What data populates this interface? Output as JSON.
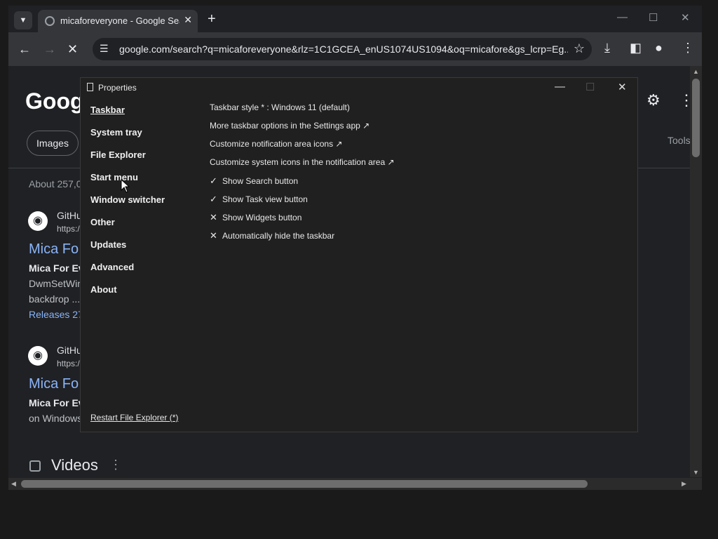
{
  "browser": {
    "tab_title": "micaforeveryone - Google Search",
    "url": "google.com/search?q=micaforeveryone&rlz=1C1GCEA_enUS1074US1094&oq=micafore&gs_lcrp=Eg..."
  },
  "google": {
    "logo": "Googl",
    "chip_images": "Images",
    "tools": "Tools",
    "about": "About 257,0",
    "results": [
      {
        "source": "GitHu",
        "url": "https:/",
        "title": "Mica Fo",
        "snippet1": "Mica For Ev",
        "snippet2": "DwmSetWin",
        "snippet3": "backdrop ...",
        "link": "Releases 27"
      },
      {
        "source": "GitHu",
        "url": "https:/",
        "title": "Mica Fo",
        "snippet1": "Mica For Ev",
        "snippet2": "on Windows"
      }
    ],
    "videos": "Videos"
  },
  "dialog": {
    "title": "Properties",
    "nav": [
      "Taskbar",
      "System tray",
      "File Explorer",
      "Start menu",
      "Window switcher",
      "Other",
      "Updates",
      "Advanced",
      "About"
    ],
    "active_nav": "Taskbar",
    "content": [
      {
        "mark": "",
        "label": "Taskbar style * : Windows 11 (default)"
      },
      {
        "mark": "",
        "label": "More taskbar options in the Settings app ↗"
      },
      {
        "mark": "",
        "label": "Customize notification area icons ↗"
      },
      {
        "mark": "",
        "label": "Customize system icons in the notification area ↗"
      },
      {
        "mark": "✓",
        "label": "Show Search button"
      },
      {
        "mark": "✓",
        "label": "Show Task view button"
      },
      {
        "mark": "✕",
        "label": "Show Widgets button"
      },
      {
        "mark": "✕",
        "label": "Automatically hide the taskbar"
      }
    ],
    "restart_link": "Restart File Explorer (*)"
  }
}
